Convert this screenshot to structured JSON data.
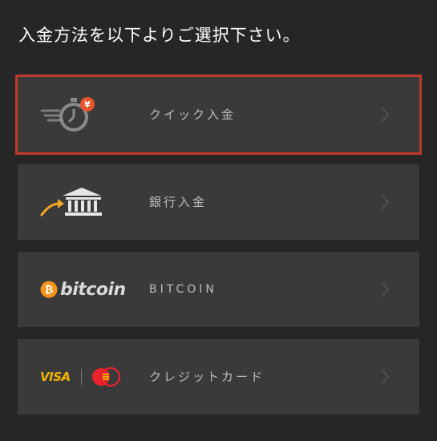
{
  "page": {
    "heading": "入金方法を以下よりご選択下さい。"
  },
  "options": [
    {
      "id": "quick",
      "label": "クイック入金",
      "icon": "stopwatch-yen-icon",
      "selected": true
    },
    {
      "id": "bank",
      "label": "銀行入金",
      "icon": "bank-transfer-icon",
      "selected": false
    },
    {
      "id": "bitcoin",
      "label": "BITCOIN",
      "icon": "bitcoin-logo",
      "logo_text": "bitcoin",
      "selected": false
    },
    {
      "id": "card",
      "label": "クレジットカード",
      "icon": "visa-mastercard-logo",
      "logo_text": "VISA",
      "selected": false
    }
  ],
  "colors": {
    "background": "#262626",
    "row_background": "#3a3a3a",
    "selected_border": "#c0392b",
    "accent_orange": "#e8542a",
    "bitcoin_orange": "#f7931a",
    "visa_gold": "#f0b400",
    "mastercard_red": "#e8242a"
  }
}
